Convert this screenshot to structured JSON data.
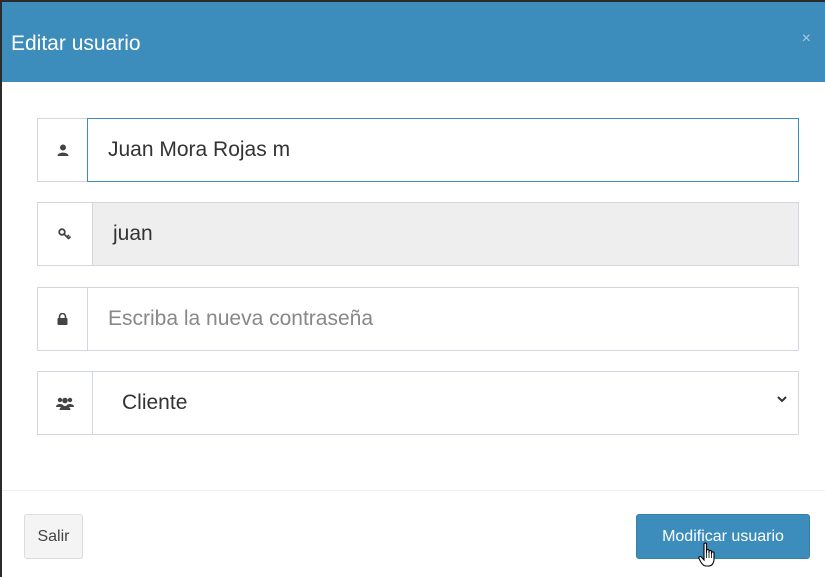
{
  "modal": {
    "title": "Editar usuario",
    "close_symbol": "×"
  },
  "form": {
    "fullname": {
      "value": "Juan Mora Rojas m",
      "icon": "user-icon"
    },
    "username": {
      "value": "juan",
      "icon": "key-icon"
    },
    "password": {
      "placeholder": "Escriba la nueva contraseña",
      "value": "",
      "icon": "lock-icon"
    },
    "role": {
      "selected": "Cliente",
      "icon": "users-icon"
    }
  },
  "footer": {
    "cancel_label": "Salir",
    "submit_label": "Modificar usuario"
  },
  "colors": {
    "header": "#3c8dbc",
    "primary_button": "#3c8dbc",
    "readonly_field": "#eeeeee"
  }
}
